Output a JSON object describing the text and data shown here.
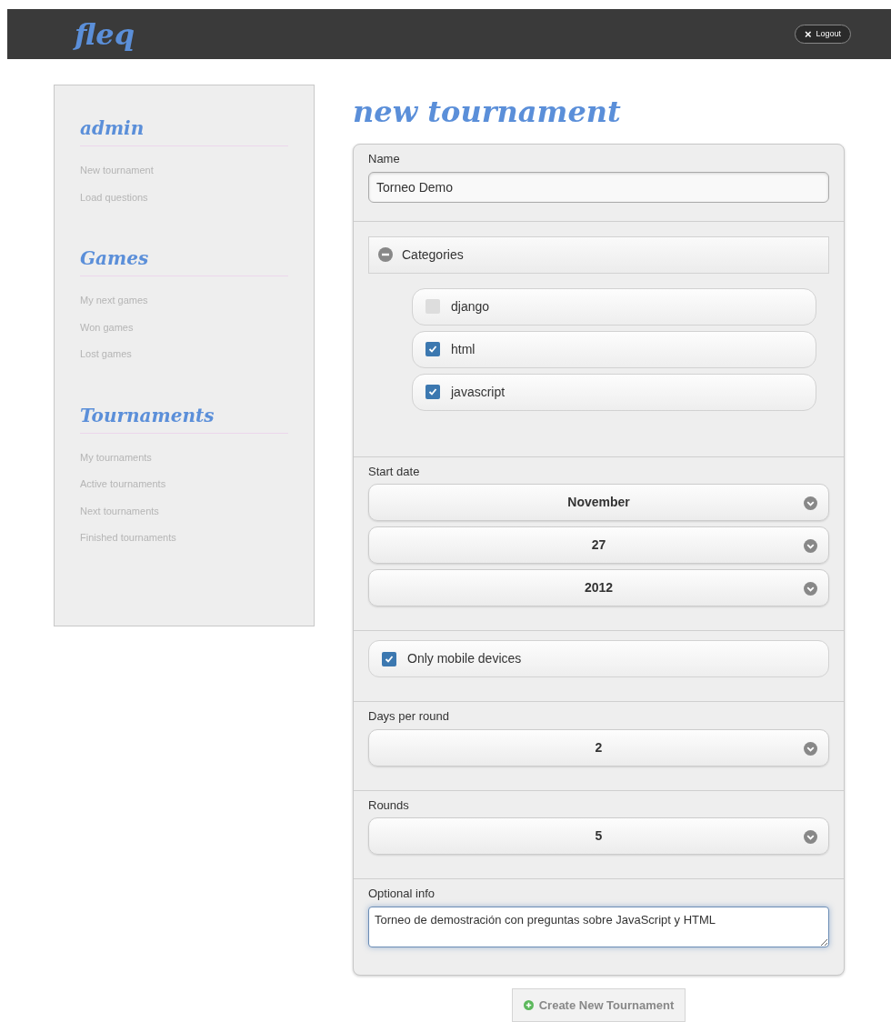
{
  "header": {
    "logo": "fleq",
    "logout_button": {
      "icon": "×",
      "label": "Logout"
    }
  },
  "sidebar": {
    "sections": [
      {
        "title": "admin",
        "items": [
          {
            "label": "New tournament"
          },
          {
            "label": "Load questions"
          }
        ]
      },
      {
        "title": "Games",
        "items": [
          {
            "label": "My next games"
          },
          {
            "label": "Won games"
          },
          {
            "label": "Lost games"
          }
        ]
      },
      {
        "title": "Tournaments",
        "items": [
          {
            "label": "My tournaments"
          },
          {
            "label": "Active tournaments"
          },
          {
            "label": "Next tournaments"
          },
          {
            "label": "Finished tournaments"
          }
        ]
      }
    ]
  },
  "page_title": "new tournament",
  "form": {
    "sections": [
      {
        "kind": "text",
        "label": "Name",
        "value": "Torneo Demo"
      },
      {
        "kind": "collapsible",
        "label": "Categories",
        "expanded": true,
        "options": [
          {
            "label": "django",
            "checked": false
          },
          {
            "label": "html",
            "checked": true
          },
          {
            "label": "javascript",
            "checked": true
          }
        ]
      },
      {
        "kind": "selects",
        "label": "Start date",
        "values": [
          "November",
          "27",
          "2012"
        ]
      },
      {
        "kind": "checkbox",
        "label": "Only mobile devices",
        "checked": true
      },
      {
        "kind": "selects",
        "label": "Days per round",
        "values": [
          "2"
        ]
      },
      {
        "kind": "selects",
        "label": "Rounds",
        "values": [
          "5"
        ]
      },
      {
        "kind": "textarea",
        "label": "Optional info",
        "value": "Torneo de demostración con preguntas sobre JavaScript y HTML"
      }
    ]
  },
  "submit_button": {
    "label": "Create New Tournament"
  }
}
